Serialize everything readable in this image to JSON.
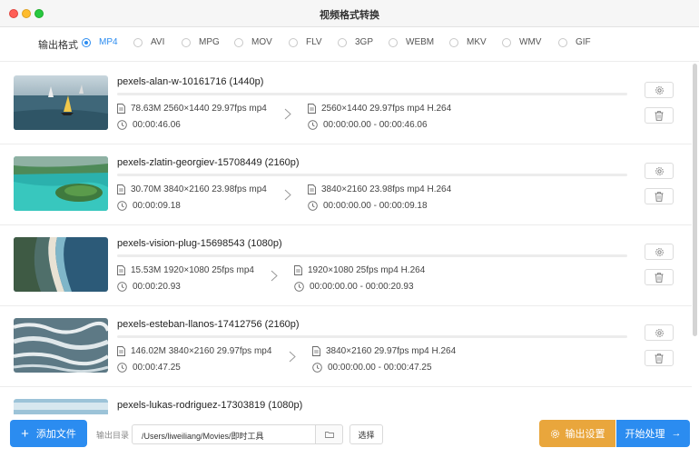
{
  "window": {
    "title": "视频格式转换"
  },
  "format_bar": {
    "label": "输出格式",
    "selected": "MP4",
    "options": [
      "MP4",
      "AVI",
      "MPG",
      "MOV",
      "FLV",
      "3GP",
      "WEBM",
      "MKV",
      "WMV",
      "GIF"
    ]
  },
  "files": [
    {
      "name": "pexels-alan-w-10161716 (1440p)",
      "src_info": "78.63M 2560×1440 29.97fps mp4",
      "src_duration": "00:00:46.06",
      "out_info": "2560×1440 29.97fps mp4 H.264",
      "out_range": "00:00:00.00 - 00:00:46.06"
    },
    {
      "name": "pexels-zlatin-georgiev-15708449 (2160p)",
      "src_info": "30.70M 3840×2160 23.98fps mp4",
      "src_duration": "00:00:09.18",
      "out_info": "3840×2160 23.98fps mp4 H.264",
      "out_range": "00:00:00.00 - 00:00:09.18"
    },
    {
      "name": "pexels-vision-plug-15698543 (1080p)",
      "src_info": "15.53M 1920×1080 25fps mp4",
      "src_duration": "00:00:20.93",
      "out_info": "1920×1080 25fps mp4 H.264",
      "out_range": "00:00:00.00 - 00:00:20.93"
    },
    {
      "name": "pexels-esteban-llanos-17412756 (2160p)",
      "src_info": "146.02M 3840×2160 29.97fps mp4",
      "src_duration": "00:00:47.25",
      "out_info": "3840×2160 29.97fps mp4 H.264",
      "out_range": "00:00:00.00 - 00:00:47.25"
    },
    {
      "name": "pexels-lukas-rodriguez-17303819 (1080p)",
      "src_info": "",
      "src_duration": "",
      "out_info": "",
      "out_range": ""
    }
  ],
  "bottom": {
    "add_label": "添加文件",
    "output_dir_label": "输出目录",
    "output_path": "/Users/liweiliang/Movies/即时工具",
    "choose_label": "选择",
    "settings_label": "输出设置",
    "start_label": "开始处理"
  },
  "colors": {
    "accent": "#2b8cf0",
    "settings": "#e9a63c"
  },
  "icons": [
    "file-icon",
    "clock-icon",
    "gear-icon",
    "trash-icon",
    "chevron-right-icon",
    "folder-icon",
    "plus-icon",
    "arrow-right-icon"
  ]
}
